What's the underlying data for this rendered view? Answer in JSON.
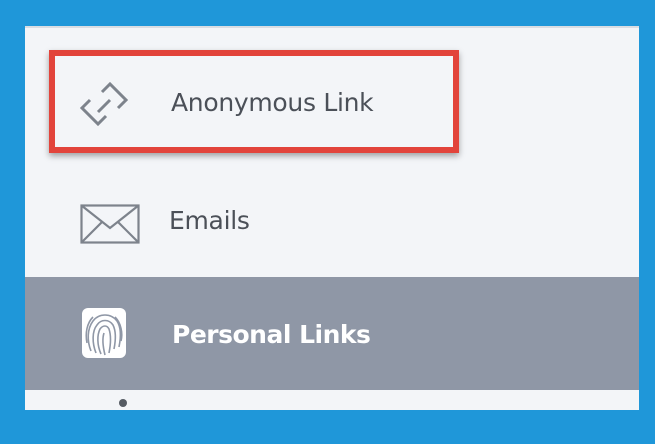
{
  "nav": {
    "items": [
      {
        "label": "Anonymous Link",
        "icon": "link-icon",
        "selected": false
      },
      {
        "label": "Emails",
        "icon": "envelope-icon",
        "selected": false
      },
      {
        "label": "Personal Links",
        "icon": "fingerprint-icon",
        "selected": true
      }
    ]
  },
  "colors": {
    "frame_border": "#1f97d9",
    "panel_background": "#f3f5f8",
    "selected_background": "#8f97a6",
    "highlight": "#e2443b",
    "text": "#4b5058",
    "selected_text": "#ffffff"
  }
}
